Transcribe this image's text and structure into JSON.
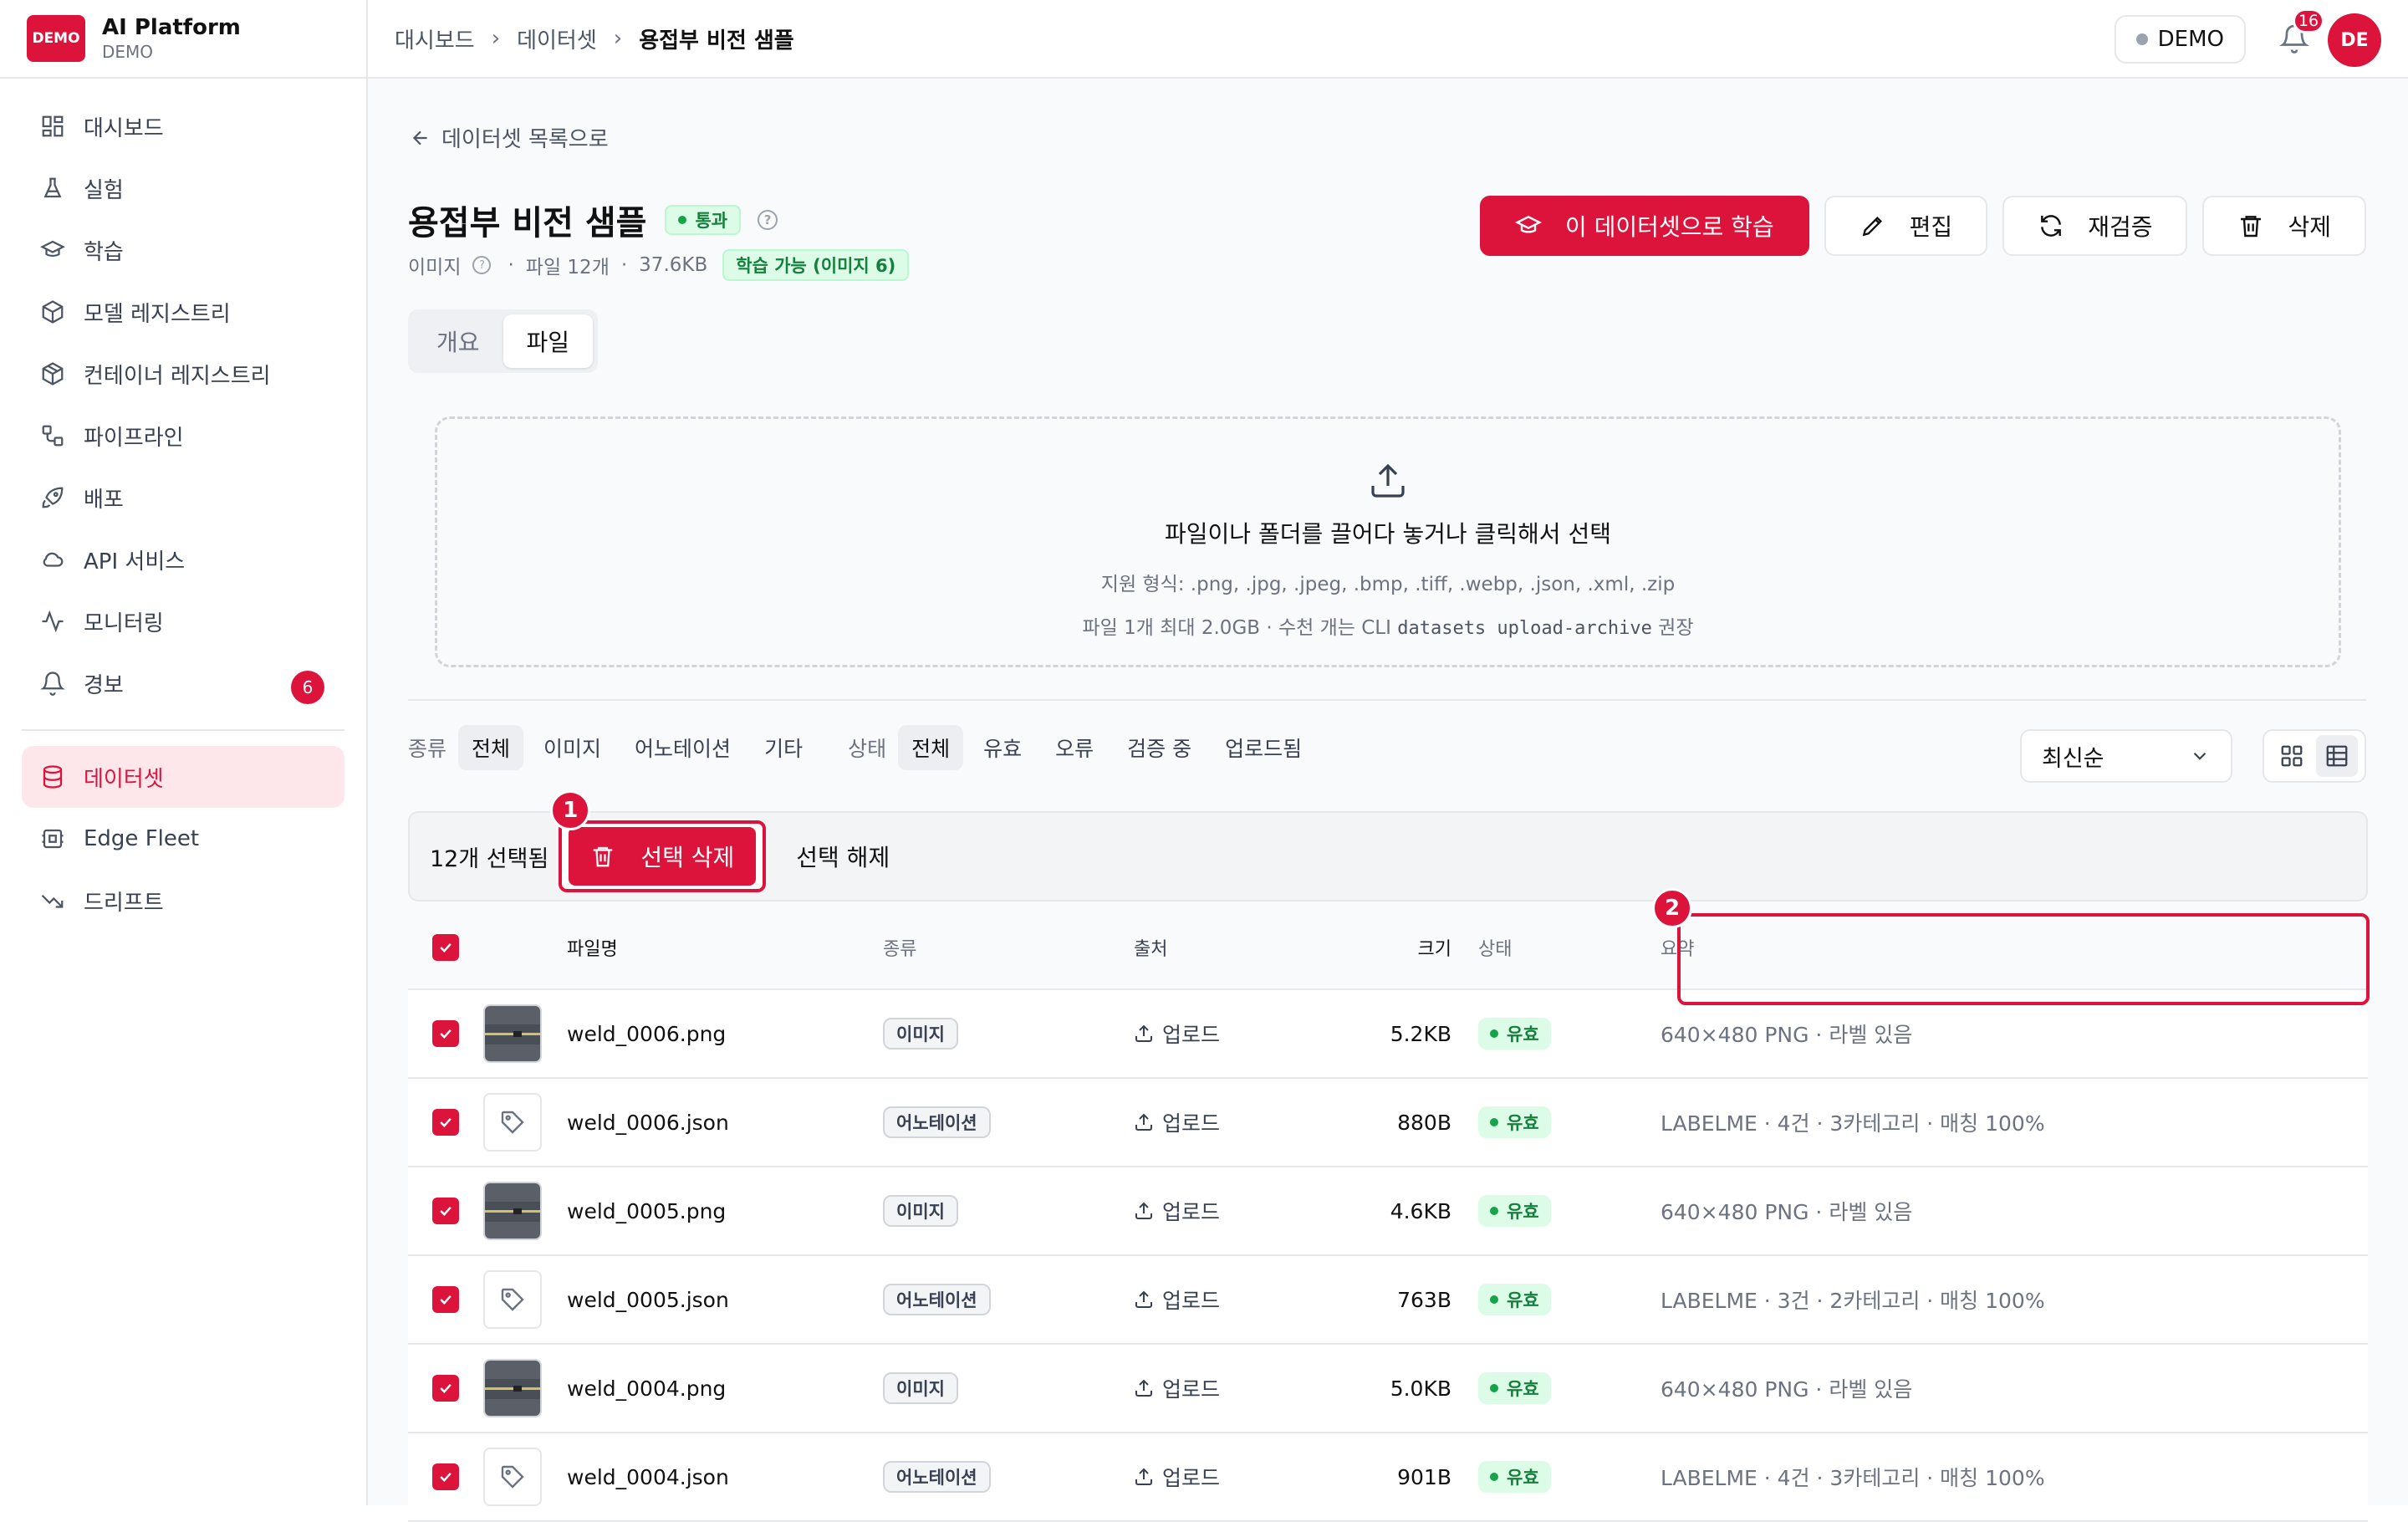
{
  "brand": {
    "logo_text": "DEMO",
    "title": "AI Platform",
    "subtitle": "DEMO"
  },
  "sidebar": {
    "items": [
      {
        "label": "대시보드",
        "icon": "dashboard-icon"
      },
      {
        "label": "실험",
        "icon": "flask-icon"
      },
      {
        "label": "학습",
        "icon": "graduation-cap-icon"
      },
      {
        "label": "모델 레지스트리",
        "icon": "cube-icon"
      },
      {
        "label": "컨테이너 레지스트리",
        "icon": "package-icon"
      },
      {
        "label": "파이프라인",
        "icon": "workflow-icon"
      },
      {
        "label": "배포",
        "icon": "rocket-icon"
      },
      {
        "label": "API 서비스",
        "icon": "cloud-icon"
      },
      {
        "label": "모니터링",
        "icon": "activity-icon"
      },
      {
        "label": "경보",
        "icon": "bell-icon",
        "badge": "6"
      }
    ],
    "secondary": [
      {
        "label": "데이터셋",
        "icon": "database-icon",
        "active": true
      },
      {
        "label": "Edge Fleet",
        "icon": "chip-icon"
      },
      {
        "label": "드리프트",
        "icon": "trend-down-icon"
      }
    ]
  },
  "topbar": {
    "breadcrumb": [
      "대시보드",
      "데이터셋",
      "용접부 비전 샘플"
    ],
    "env_label": "DEMO",
    "notif_count": "16",
    "avatar": "DE"
  },
  "page": {
    "back_label": "데이터셋 목록으로",
    "title": "용접부 비전 샘플",
    "status_badge": "통과",
    "meta_type": "이미지",
    "meta_files": "파일 12개",
    "meta_size": "37.6KB",
    "meta_dot": "·",
    "trainable_badge": "학습 가능 (이미지 6)",
    "actions": {
      "train": "이 데이터셋으로 학습",
      "edit": "편집",
      "revalidate": "재검증",
      "delete": "삭제"
    },
    "tabs": [
      {
        "label": "개요"
      },
      {
        "label": "파일",
        "active": true
      }
    ]
  },
  "dropzone": {
    "main": "파일이나 폴더를 끌어다 놓거나 클릭해서 선택",
    "formats": "지원 형식: .png, .jpg, .jpeg, .bmp, .tiff, .webp, .json, .xml, .zip",
    "limit_prefix": "파일 1개 최대 2.0GB · 수천 개는 CLI",
    "limit_code": "datasets upload-archive",
    "limit_suffix": "권장"
  },
  "filters": {
    "kind_label": "종류",
    "kinds": [
      "전체",
      "이미지",
      "어노테이션",
      "기타"
    ],
    "status_label": "상태",
    "statuses": [
      "전체",
      "유효",
      "오류",
      "검증 중",
      "업로드됨"
    ],
    "sort": "최신순"
  },
  "selection": {
    "count": "12개 선택됨",
    "bulk_delete": "선택 삭제",
    "clear": "선택 해제",
    "marker1": "1",
    "marker2": "2"
  },
  "table": {
    "headers": {
      "name": "파일명",
      "type": "종류",
      "source": "출처",
      "size": "크기",
      "status": "상태",
      "summary": "요약"
    },
    "rows": [
      {
        "name": "weld_0006.png",
        "type": "이미지",
        "source": "업로드",
        "size": "5.2KB",
        "status": "유효",
        "summary": "640×480 PNG · 라벨 있음",
        "kind": "image"
      },
      {
        "name": "weld_0006.json",
        "type": "어노테이션",
        "source": "업로드",
        "size": "880B",
        "status": "유효",
        "summary": "LABELME · 4건 · 3카테고리 · 매칭 100%",
        "kind": "ann"
      },
      {
        "name": "weld_0005.png",
        "type": "이미지",
        "source": "업로드",
        "size": "4.6KB",
        "status": "유효",
        "summary": "640×480 PNG · 라벨 있음",
        "kind": "image"
      },
      {
        "name": "weld_0005.json",
        "type": "어노테이션",
        "source": "업로드",
        "size": "763B",
        "status": "유효",
        "summary": "LABELME · 3건 · 2카테고리 · 매칭 100%",
        "kind": "ann"
      },
      {
        "name": "weld_0004.png",
        "type": "이미지",
        "source": "업로드",
        "size": "5.0KB",
        "status": "유효",
        "summary": "640×480 PNG · 라벨 있음",
        "kind": "image"
      },
      {
        "name": "weld_0004.json",
        "type": "어노테이션",
        "source": "업로드",
        "size": "901B",
        "status": "유효",
        "summary": "LABELME · 4건 · 3카테고리 · 매칭 100%",
        "kind": "ann"
      }
    ]
  },
  "colors": {
    "accent": "#dc143c",
    "success": "#15803d",
    "success_bg": "#dcfce7"
  }
}
